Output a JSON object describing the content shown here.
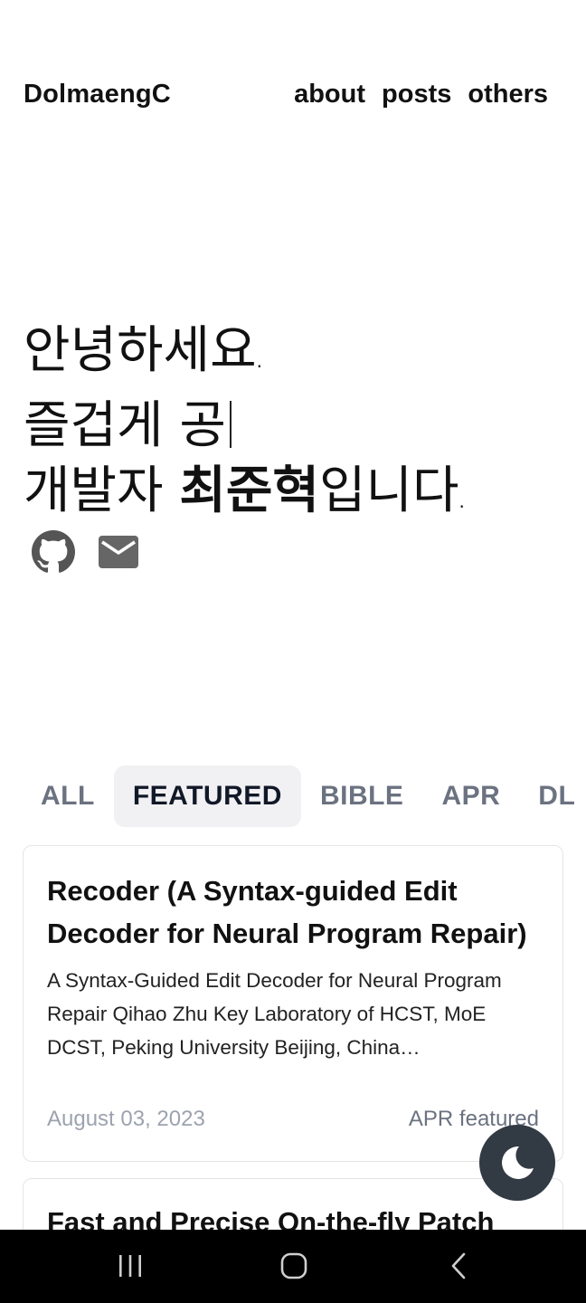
{
  "header": {
    "logo": "DolmaengC",
    "nav": [
      "about",
      "posts",
      "others"
    ]
  },
  "intro": {
    "line1": "안녕하세요",
    "line2": "즐겁게 공",
    "line3_prefix": "개발자 ",
    "line3_name": "최준혁",
    "line3_suffix": "입니다",
    "period": "."
  },
  "social": {
    "github_icon": "github-icon",
    "mail_icon": "mail-icon"
  },
  "tabs": {
    "items": [
      "ALL",
      "FEATURED",
      "BIBLE",
      "APR",
      "DL"
    ],
    "active": "FEATURED"
  },
  "posts": [
    {
      "title": "Recoder (A Syntax-guided Edit Decoder for Neural Program Repair)",
      "description": "A Syntax-Guided Edit Decoder for Neural Program Repair Qihao Zhu Key Laboratory of HCST, MoE DCST, Peking University Beijing, China…",
      "date": "August 03, 2023",
      "tags": "APR featured"
    },
    {
      "title": "Fast and Precise On-the-fly Patch"
    }
  ],
  "theme_toggle": {
    "icon": "moon-icon"
  },
  "system_nav": {
    "recents_icon": "recents-icon",
    "home_icon": "home-icon",
    "back_icon": "back-icon"
  },
  "colors": {
    "text": "#111111",
    "tab_inactive": "#6b7280",
    "tab_active_bg": "#f1f1f3",
    "date": "#9ca3af",
    "toggle_bg": "#323a44",
    "navbar": "#000000"
  }
}
